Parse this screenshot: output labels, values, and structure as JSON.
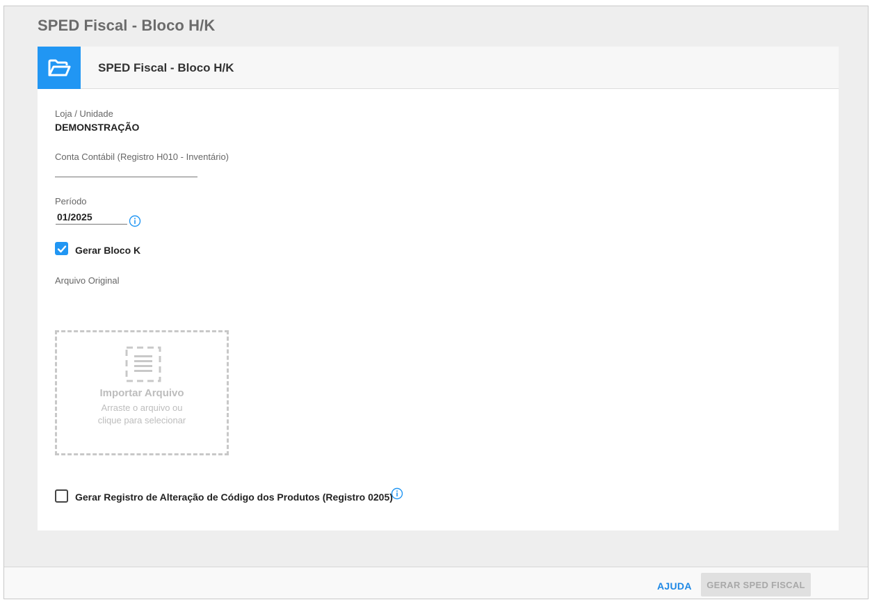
{
  "page": {
    "title": "SPED Fiscal - Bloco H/K"
  },
  "card": {
    "title": "SPED Fiscal - Bloco H/K",
    "icon": "folder-open-icon"
  },
  "form": {
    "loja": {
      "label": "Loja / Unidade",
      "value": "DEMONSTRAÇÃO"
    },
    "conta_contabil": {
      "label": "Conta Contábil (Registro H010 - Inventário)",
      "value": ""
    },
    "periodo": {
      "label": "Período",
      "value": "01/2025",
      "info_icon": "info-icon"
    },
    "gerar_bloco_k": {
      "label": "Gerar Bloco K",
      "checked": true
    },
    "arquivo_original": {
      "label": "Arquivo Original",
      "dropzone_title": "Importar Arquivo",
      "dropzone_subtitle": "Arraste o arquivo ou clique para selecionar",
      "icon": "document-icon"
    },
    "gerar_registro_0205": {
      "label": "Gerar Registro de Alteração de Código dos Produtos (Registro 0205)",
      "checked": false,
      "info_icon": "info-icon"
    }
  },
  "footer": {
    "help_label": "AJUDA",
    "generate_label": "GERAR SPED FISCAL",
    "generate_enabled": false
  },
  "colors": {
    "accent": "#2196f3",
    "link": "#1e88e5",
    "background": "#eeeeee",
    "disabled_button": "#e0e0e0",
    "dropzone_border": "#c8c8c8"
  }
}
